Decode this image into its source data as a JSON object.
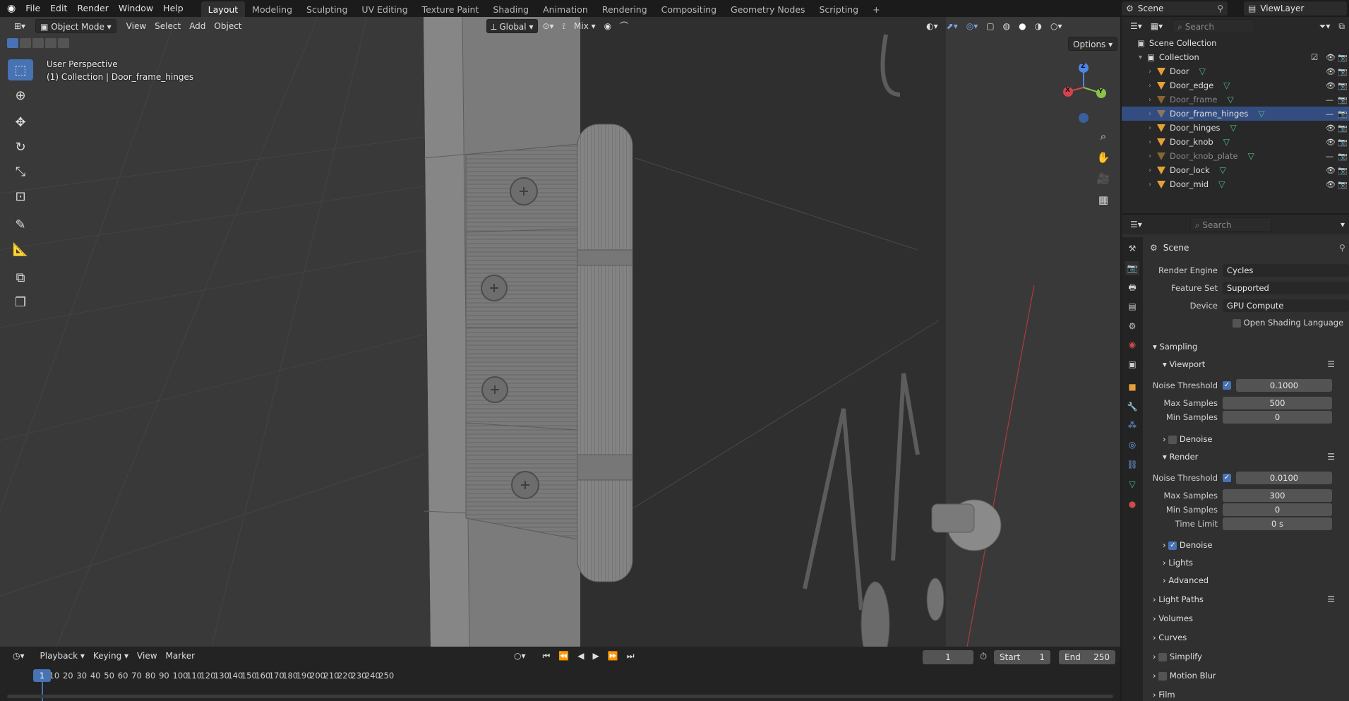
{
  "menu": {
    "items": [
      "File",
      "Edit",
      "Render",
      "Window",
      "Help"
    ],
    "workspaces": [
      "Layout",
      "Modeling",
      "Sculpting",
      "UV Editing",
      "Texture Paint",
      "Shading",
      "Animation",
      "Rendering",
      "Compositing",
      "Geometry Nodes",
      "Scripting"
    ],
    "active_workspace": "Layout",
    "add_tab": "+",
    "scene": "Scene",
    "view_layer": "ViewLayer"
  },
  "viewport": {
    "mode": "Object Mode",
    "menus": [
      "View",
      "Select",
      "Add",
      "Object"
    ],
    "transform_orientation": "Global",
    "snap_mode": "Mix",
    "options_label": "Options",
    "overlay_line1": "User Perspective",
    "overlay_line2": "(1) Collection | Door_frame_hinges",
    "gizmo": {
      "x": "X",
      "y": "Y",
      "z": "Z"
    }
  },
  "timeline": {
    "menus": [
      "Playback",
      "Keying",
      "View",
      "Marker"
    ],
    "current_frame": "1",
    "start_label": "Start",
    "start_value": "1",
    "end_label": "End",
    "end_value": "250",
    "ticks": [
      "1",
      "10",
      "20",
      "30",
      "40",
      "50",
      "60",
      "70",
      "80",
      "90",
      "100",
      "110",
      "120",
      "130",
      "140",
      "150",
      "160",
      "170",
      "180",
      "190",
      "200",
      "210",
      "220",
      "230",
      "240",
      "250"
    ]
  },
  "outliner": {
    "search_placeholder": "Search",
    "scene_collection": "Scene Collection",
    "collection": "Collection",
    "objects": [
      {
        "name": "Door",
        "selected": false,
        "hidden": false
      },
      {
        "name": "Door_edge",
        "selected": false,
        "hidden": false
      },
      {
        "name": "Door_frame",
        "selected": false,
        "hidden": true
      },
      {
        "name": "Door_frame_hinges",
        "selected": true,
        "hidden": true
      },
      {
        "name": "Door_hinges",
        "selected": false,
        "hidden": false
      },
      {
        "name": "Door_knob",
        "selected": false,
        "hidden": false
      },
      {
        "name": "Door_knob_plate",
        "selected": false,
        "hidden": true
      },
      {
        "name": "Door_lock",
        "selected": false,
        "hidden": false
      },
      {
        "name": "Door_mid",
        "selected": false,
        "hidden": false
      }
    ]
  },
  "properties": {
    "search_placeholder": "Search",
    "context": "Scene",
    "render_engine_label": "Render Engine",
    "render_engine": "Cycles",
    "feature_set_label": "Feature Set",
    "feature_set": "Supported",
    "device_label": "Device",
    "device": "GPU Compute",
    "osl_label": "Open Shading Language",
    "sampling": "Sampling",
    "viewport": {
      "title": "Viewport",
      "noise_threshold_label": "Noise Threshold",
      "noise_threshold": "0.1000",
      "max_samples_label": "Max Samples",
      "max_samples": "500",
      "min_samples_label": "Min Samples",
      "min_samples": "0",
      "denoise_label": "Denoise"
    },
    "render": {
      "title": "Render",
      "noise_threshold_label": "Noise Threshold",
      "noise_threshold": "0.0100",
      "max_samples_label": "Max Samples",
      "max_samples": "300",
      "min_samples_label": "Min Samples",
      "min_samples": "0",
      "time_limit_label": "Time Limit",
      "time_limit": "0 s",
      "denoise_label": "Denoise"
    },
    "lights": "Lights",
    "advanced": "Advanced",
    "sections": [
      "Light Paths",
      "Volumes",
      "Curves",
      "Simplify",
      "Motion Blur",
      "Film"
    ]
  }
}
